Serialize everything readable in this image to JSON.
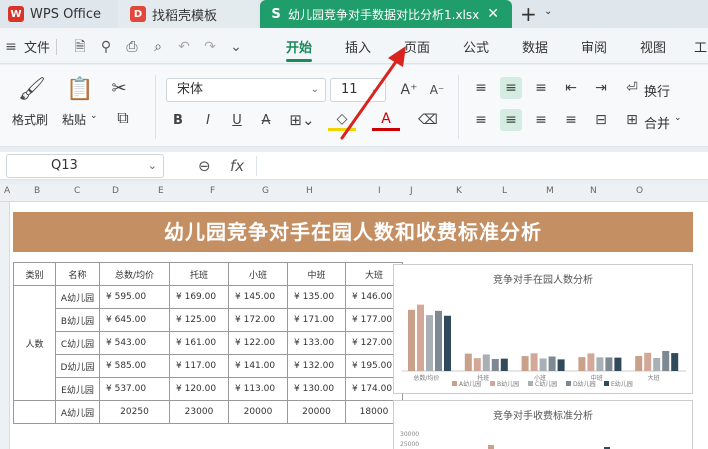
{
  "tabs": [
    {
      "label": "WPS Office",
      "icon": "W"
    },
    {
      "label": "找稻壳模板",
      "icon": "D"
    },
    {
      "label": "幼儿园竞争对手数据对比分析1.xlsx",
      "icon": "S"
    }
  ],
  "tab_close": "✕",
  "new_tab": "+",
  "menu": {
    "file": "文件",
    "items": [
      "开始",
      "插入",
      "页面",
      "公式",
      "数据",
      "审阅",
      "视图",
      "工"
    ]
  },
  "ribbon": {
    "format_painter": "格式刷",
    "paste": "粘贴",
    "font_name": "宋体",
    "font_size": "11",
    "wrap": "换行",
    "merge": "合并"
  },
  "formula": {
    "cell_ref": "Q13",
    "fx": "fx"
  },
  "columns": [
    "A",
    "B",
    "C",
    "D",
    "E",
    "F",
    "G",
    "H",
    "I",
    "J",
    "K",
    "L",
    "M",
    "N",
    "O"
  ],
  "banner_title": "幼儿园竞争对手在园人数和收费标准分析",
  "table": {
    "headers": [
      "类别",
      "名称",
      "总数/均价",
      "托班",
      "小班",
      "中班",
      "大班"
    ],
    "category": "人数",
    "rows": [
      [
        "A幼儿园",
        "¥ 595.00",
        "¥ 169.00",
        "¥ 145.00",
        "¥ 135.00",
        "¥ 146.00"
      ],
      [
        "B幼儿园",
        "¥ 645.00",
        "¥ 125.00",
        "¥ 172.00",
        "¥ 171.00",
        "¥ 177.00"
      ],
      [
        "C幼儿园",
        "¥ 543.00",
        "¥ 161.00",
        "¥ 122.00",
        "¥ 133.00",
        "¥ 127.00"
      ],
      [
        "D幼儿园",
        "¥ 585.00",
        "¥ 117.00",
        "¥ 141.00",
        "¥ 132.00",
        "¥ 195.00"
      ],
      [
        "E幼儿园",
        "¥ 537.00",
        "¥ 120.00",
        "¥ 113.00",
        "¥ 130.00",
        "¥ 174.00"
      ],
      [
        "A幼儿园",
        "20250",
        "23000",
        "20000",
        "20000",
        "18000"
      ]
    ]
  },
  "chart1": {
    "title": "竞争对手在园人数分析",
    "categories": [
      "总数/均价",
      "托班",
      "小班",
      "中班",
      "大班"
    ],
    "legend": [
      "A幼儿园",
      "B幼儿园",
      "C幼儿园",
      "D幼儿园",
      "E幼儿园"
    ],
    "colors": [
      "#c9a08a",
      "#d4a898",
      "#a8b0b6",
      "#7e8a93",
      "#2f4a5a"
    ],
    "values": [
      [
        595,
        645,
        543,
        585,
        537
      ],
      [
        169,
        125,
        161,
        117,
        120
      ],
      [
        145,
        172,
        122,
        141,
        113
      ],
      [
        135,
        171,
        133,
        132,
        130
      ],
      [
        146,
        177,
        127,
        195,
        174
      ]
    ],
    "ymax": 700
  },
  "chart2": {
    "title": "竞争对手收费标准分析",
    "yticks": [
      "30000",
      "25000"
    ]
  }
}
